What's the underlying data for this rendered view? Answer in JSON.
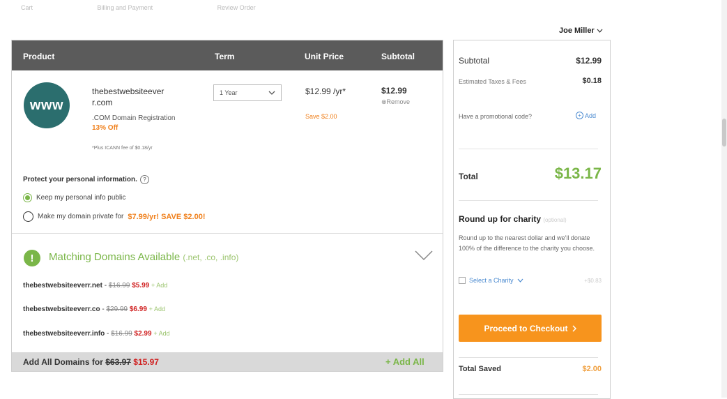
{
  "topnav": [
    "Cart",
    "Billing and Payment",
    "Review Order"
  ],
  "user": {
    "name": "Joe Miller"
  },
  "cart": {
    "columns": {
      "product": "Product",
      "term": "Term",
      "unit_price": "Unit Price",
      "subtotal": "Subtotal"
    },
    "item": {
      "logo_text": "www",
      "name": "thebestwebsiteever r.com",
      "description": ".COM Domain Registration",
      "discount": "13% Off",
      "fee_note": "*Plus ICANN fee of $0.18/yr",
      "term": "1 Year",
      "unit_price": "$12.99 /yr*",
      "unit_save": "Save $2.00",
      "subtotal": "$12.99",
      "remove_label": "Remove"
    },
    "privacy": {
      "title": "Protect your personal information.",
      "help_icon": "?",
      "option_public": "Keep my personal info public",
      "option_private_prefix": "Make my domain private for",
      "option_private_price": "$7.99/yr! SAVE $2.00!",
      "selected": "public"
    },
    "matching": {
      "icon": "!",
      "title": "Matching Domains Available",
      "subtitle": "(.net, .co, .info)",
      "domains": [
        {
          "name": "thebestwebsiteeverr.net",
          "old_price": "$16.99",
          "price": "$5.99",
          "add": "+ Add"
        },
        {
          "name": "thebestwebsiteeverr.co",
          "old_price": "$29.99",
          "price": "$6.99",
          "add": "+ Add"
        },
        {
          "name": "thebestwebsiteeverr.info",
          "old_price": "$16.99",
          "price": "$2.99",
          "add": "+ Add"
        }
      ],
      "add_all_prefix": "Add All Domains for",
      "add_all_old": "$63.97",
      "add_all_price": "$15.97",
      "add_all_button": "+ Add All"
    }
  },
  "summary": {
    "subtotal_label": "Subtotal",
    "subtotal_value": "$12.99",
    "taxes_label": "Estimated Taxes & Fees",
    "taxes_value": "$0.18",
    "promo_label": "Have a promotional code?",
    "promo_add": "Add",
    "total_label": "Total",
    "total_value": "$13.17",
    "charity_title": "Round up for charity",
    "charity_optional": "(optional)",
    "charity_desc": "Round up to the nearest dollar and we'll donate 100% of the difference to the charity you choose.",
    "charity_select": "Select a Charity",
    "charity_amount": "+$0.83",
    "checkout_label": "Proceed to Checkout",
    "saved_label": "Total Saved",
    "saved_value": "$2.00"
  },
  "colors": {
    "accent_green": "#7ab648",
    "accent_orange": "#f7941d",
    "header_gray": "#5b5b5b",
    "price_red": "#d02020"
  }
}
